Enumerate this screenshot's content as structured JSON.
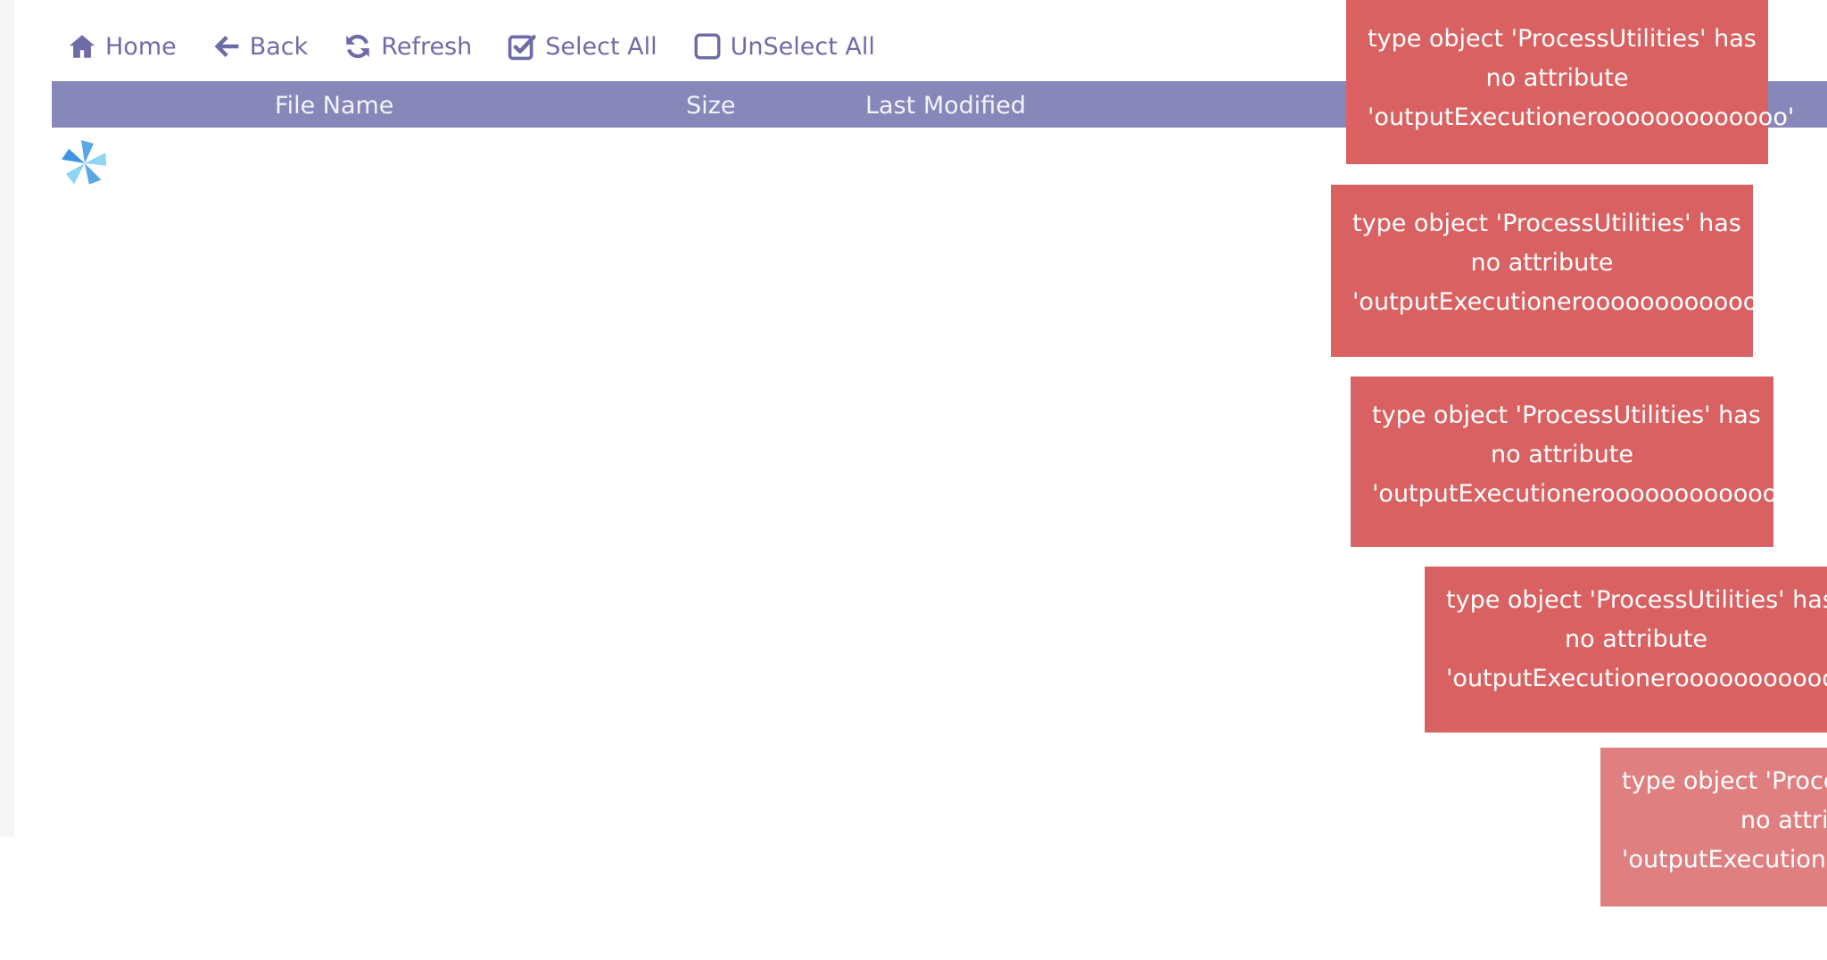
{
  "toolbar": {
    "home_label": "Home",
    "back_label": "Back",
    "refresh_label": "Refresh",
    "select_all_label": "Select All",
    "unselect_all_label": "UnSelect All",
    "icons": [
      "home-icon",
      "back-arrow-icon",
      "refresh-icon",
      "checked-box-icon",
      "empty-checkbox-icon"
    ]
  },
  "file_table": {
    "columns": [
      "File Name",
      "Size",
      "Last Modified"
    ],
    "header_color": "#8788b9"
  },
  "loading": {
    "icon": "pinwheel-spinner-icon",
    "colors": [
      "#5aa7e8",
      "#8fd3f5"
    ]
  },
  "notifications": [
    {
      "line1": "type object 'ProcessUtilities' has",
      "line2": "no attribute",
      "line3": "'outputExecutionerooooooooooooo'"
    },
    {
      "line1": "type object 'ProcessUtilities' has",
      "line2": "no attribute",
      "line3": "'outputExecutionerooooooooooooo'"
    },
    {
      "line1": "type object 'ProcessUtilities' has",
      "line2": "no attribute",
      "line3": "'outputExecutionerooooooooooooo'"
    },
    {
      "line1": "type object 'ProcessUtilities' has",
      "line2": "no attribute",
      "line3": "'outputExecutionerooooooooooooo'"
    },
    {
      "line1": "type object 'ProcessUtilities' has",
      "line2": "no attribute",
      "line3": "'outputExecutionerooooooooooooo'"
    }
  ],
  "colors": {
    "accent": "#6e6ca6",
    "error_toast": "#d96162",
    "error_toast_fading": "#e07f80"
  }
}
